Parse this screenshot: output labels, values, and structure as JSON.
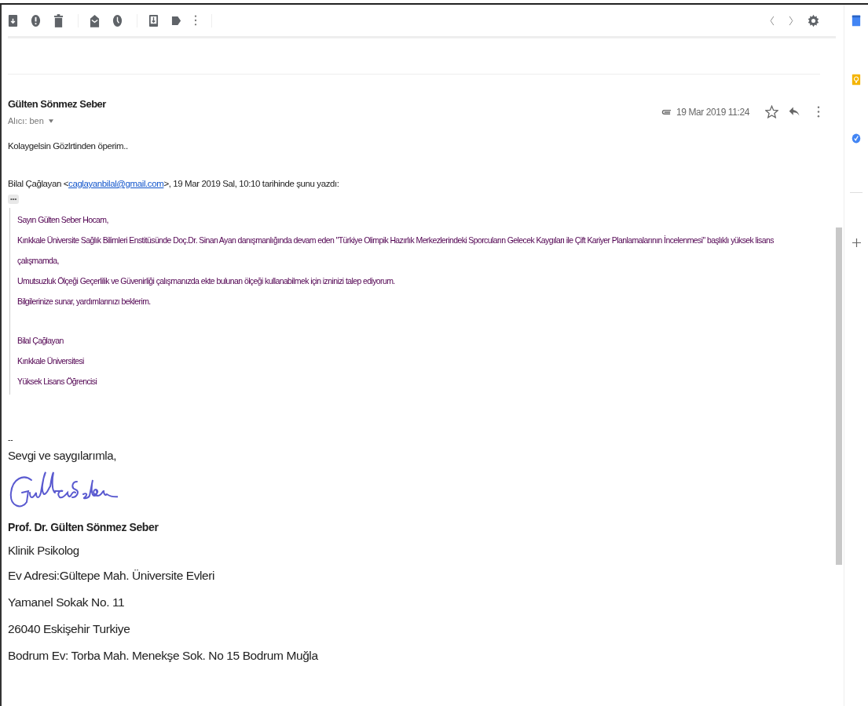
{
  "message": {
    "sender": "Gülten Sönmez Seber",
    "recipient": "Alıcı: ben",
    "date": "19 Mar 2019 11:24",
    "starred": false,
    "body": "Kolaygelsin Gözlrtinden öperim..",
    "quote_header": {
      "name": "Bilal Çağlayan <",
      "email": "caglayanbilal@gmail.com",
      "rest": ">, 19 Mar 2019 Sal, 10:10 tarihinde şunu yazdı:"
    },
    "ellipsis": "•••",
    "quote_paragraph": [
      "Sayın Gülten Seber Hocam,",
      "Kırıkkale Üniversite Sağlık Bilimleri Enstitüsünde Doç.Dr. Sinan Ayan danışmanlığında devam eden \"Türkiye Olimpik Hazırlık Merkezlerindeki Sporcuların Gelecek Kaygıları ile Çift Kariyer Planlamalarının İncelenmesi\"  başlıklı yüksek lisans çalışmamda,",
      "Umutsuzluk Ölçeği Geçerlilik ve Güvenirliği çalışmanızda ekte bulunan ölçeği kullanabilmek için izninizi talep ediyorum.",
      "Bilgilerinize sunar, yardımlarınızı beklerim."
    ],
    "quote_signature": [
      "Bilal Çağlayan",
      "Kırıkkale Üniversitesi",
      "Yüksek Lisans Öğrencisi"
    ],
    "sig_separator": "--",
    "closing": "Sevgi ve saygılarımla,",
    "sig_name": "Prof. Dr. Gülten Sönmez Seber",
    "sig_title": "Klinik Psikolog",
    "sig_address": [
      "Ev Adresi:Gültepe Mah. Üniversite Evleri",
      "Yamanel Sokak No. 11",
      "26040 Eskişehir Turkiye",
      "Bodrum Ev: Torba Mah. Menekşe Sok. No 15 Bodrum Muğla"
    ]
  }
}
